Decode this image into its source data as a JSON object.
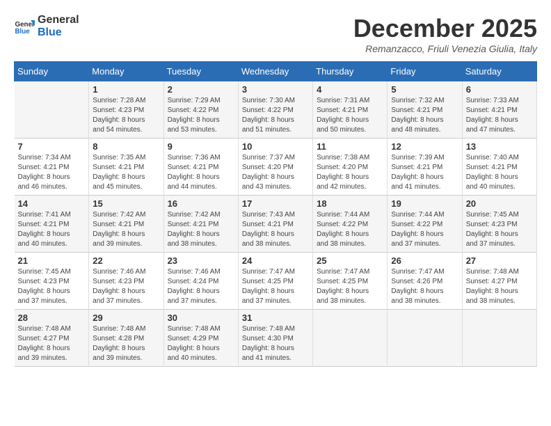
{
  "logo": {
    "line1": "General",
    "line2": "Blue"
  },
  "title": "December 2025",
  "location": "Remanzacco, Friuli Venezia Giulia, Italy",
  "weekdays": [
    "Sunday",
    "Monday",
    "Tuesday",
    "Wednesday",
    "Thursday",
    "Friday",
    "Saturday"
  ],
  "weeks": [
    [
      {
        "day": "",
        "sunrise": "",
        "sunset": "",
        "daylight": ""
      },
      {
        "day": "1",
        "sunrise": "7:28 AM",
        "sunset": "4:23 PM",
        "hours": "8 hours",
        "minutes": "54 minutes"
      },
      {
        "day": "2",
        "sunrise": "7:29 AM",
        "sunset": "4:22 PM",
        "hours": "8 hours",
        "minutes": "53 minutes"
      },
      {
        "day": "3",
        "sunrise": "7:30 AM",
        "sunset": "4:22 PM",
        "hours": "8 hours",
        "minutes": "51 minutes"
      },
      {
        "day": "4",
        "sunrise": "7:31 AM",
        "sunset": "4:21 PM",
        "hours": "8 hours",
        "minutes": "50 minutes"
      },
      {
        "day": "5",
        "sunrise": "7:32 AM",
        "sunset": "4:21 PM",
        "hours": "8 hours",
        "minutes": "48 minutes"
      },
      {
        "day": "6",
        "sunrise": "7:33 AM",
        "sunset": "4:21 PM",
        "hours": "8 hours",
        "minutes": "47 minutes"
      }
    ],
    [
      {
        "day": "7",
        "sunrise": "7:34 AM",
        "sunset": "4:21 PM",
        "hours": "8 hours",
        "minutes": "46 minutes"
      },
      {
        "day": "8",
        "sunrise": "7:35 AM",
        "sunset": "4:21 PM",
        "hours": "8 hours",
        "minutes": "45 minutes"
      },
      {
        "day": "9",
        "sunrise": "7:36 AM",
        "sunset": "4:21 PM",
        "hours": "8 hours",
        "minutes": "44 minutes"
      },
      {
        "day": "10",
        "sunrise": "7:37 AM",
        "sunset": "4:20 PM",
        "hours": "8 hours",
        "minutes": "43 minutes"
      },
      {
        "day": "11",
        "sunrise": "7:38 AM",
        "sunset": "4:20 PM",
        "hours": "8 hours",
        "minutes": "42 minutes"
      },
      {
        "day": "12",
        "sunrise": "7:39 AM",
        "sunset": "4:21 PM",
        "hours": "8 hours",
        "minutes": "41 minutes"
      },
      {
        "day": "13",
        "sunrise": "7:40 AM",
        "sunset": "4:21 PM",
        "hours": "8 hours",
        "minutes": "40 minutes"
      }
    ],
    [
      {
        "day": "14",
        "sunrise": "7:41 AM",
        "sunset": "4:21 PM",
        "hours": "8 hours",
        "minutes": "40 minutes"
      },
      {
        "day": "15",
        "sunrise": "7:42 AM",
        "sunset": "4:21 PM",
        "hours": "8 hours",
        "minutes": "39 minutes"
      },
      {
        "day": "16",
        "sunrise": "7:42 AM",
        "sunset": "4:21 PM",
        "hours": "8 hours",
        "minutes": "38 minutes"
      },
      {
        "day": "17",
        "sunrise": "7:43 AM",
        "sunset": "4:21 PM",
        "hours": "8 hours",
        "minutes": "38 minutes"
      },
      {
        "day": "18",
        "sunrise": "7:44 AM",
        "sunset": "4:22 PM",
        "hours": "8 hours",
        "minutes": "38 minutes"
      },
      {
        "day": "19",
        "sunrise": "7:44 AM",
        "sunset": "4:22 PM",
        "hours": "8 hours",
        "minutes": "37 minutes"
      },
      {
        "day": "20",
        "sunrise": "7:45 AM",
        "sunset": "4:23 PM",
        "hours": "8 hours",
        "minutes": "37 minutes"
      }
    ],
    [
      {
        "day": "21",
        "sunrise": "7:45 AM",
        "sunset": "4:23 PM",
        "hours": "8 hours",
        "minutes": "37 minutes"
      },
      {
        "day": "22",
        "sunrise": "7:46 AM",
        "sunset": "4:23 PM",
        "hours": "8 hours",
        "minutes": "37 minutes"
      },
      {
        "day": "23",
        "sunrise": "7:46 AM",
        "sunset": "4:24 PM",
        "hours": "8 hours",
        "minutes": "37 minutes"
      },
      {
        "day": "24",
        "sunrise": "7:47 AM",
        "sunset": "4:25 PM",
        "hours": "8 hours",
        "minutes": "37 minutes"
      },
      {
        "day": "25",
        "sunrise": "7:47 AM",
        "sunset": "4:25 PM",
        "hours": "8 hours",
        "minutes": "38 minutes"
      },
      {
        "day": "26",
        "sunrise": "7:47 AM",
        "sunset": "4:26 PM",
        "hours": "8 hours",
        "minutes": "38 minutes"
      },
      {
        "day": "27",
        "sunrise": "7:48 AM",
        "sunset": "4:27 PM",
        "hours": "8 hours",
        "minutes": "38 minutes"
      }
    ],
    [
      {
        "day": "28",
        "sunrise": "7:48 AM",
        "sunset": "4:27 PM",
        "hours": "8 hours",
        "minutes": "39 minutes"
      },
      {
        "day": "29",
        "sunrise": "7:48 AM",
        "sunset": "4:28 PM",
        "hours": "8 hours",
        "minutes": "39 minutes"
      },
      {
        "day": "30",
        "sunrise": "7:48 AM",
        "sunset": "4:29 PM",
        "hours": "8 hours",
        "minutes": "40 minutes"
      },
      {
        "day": "31",
        "sunrise": "7:48 AM",
        "sunset": "4:30 PM",
        "hours": "8 hours",
        "minutes": "41 minutes"
      },
      {
        "day": "",
        "sunrise": "",
        "sunset": "",
        "hours": "",
        "minutes": ""
      },
      {
        "day": "",
        "sunrise": "",
        "sunset": "",
        "hours": "",
        "minutes": ""
      },
      {
        "day": "",
        "sunrise": "",
        "sunset": "",
        "hours": "",
        "minutes": ""
      }
    ]
  ]
}
